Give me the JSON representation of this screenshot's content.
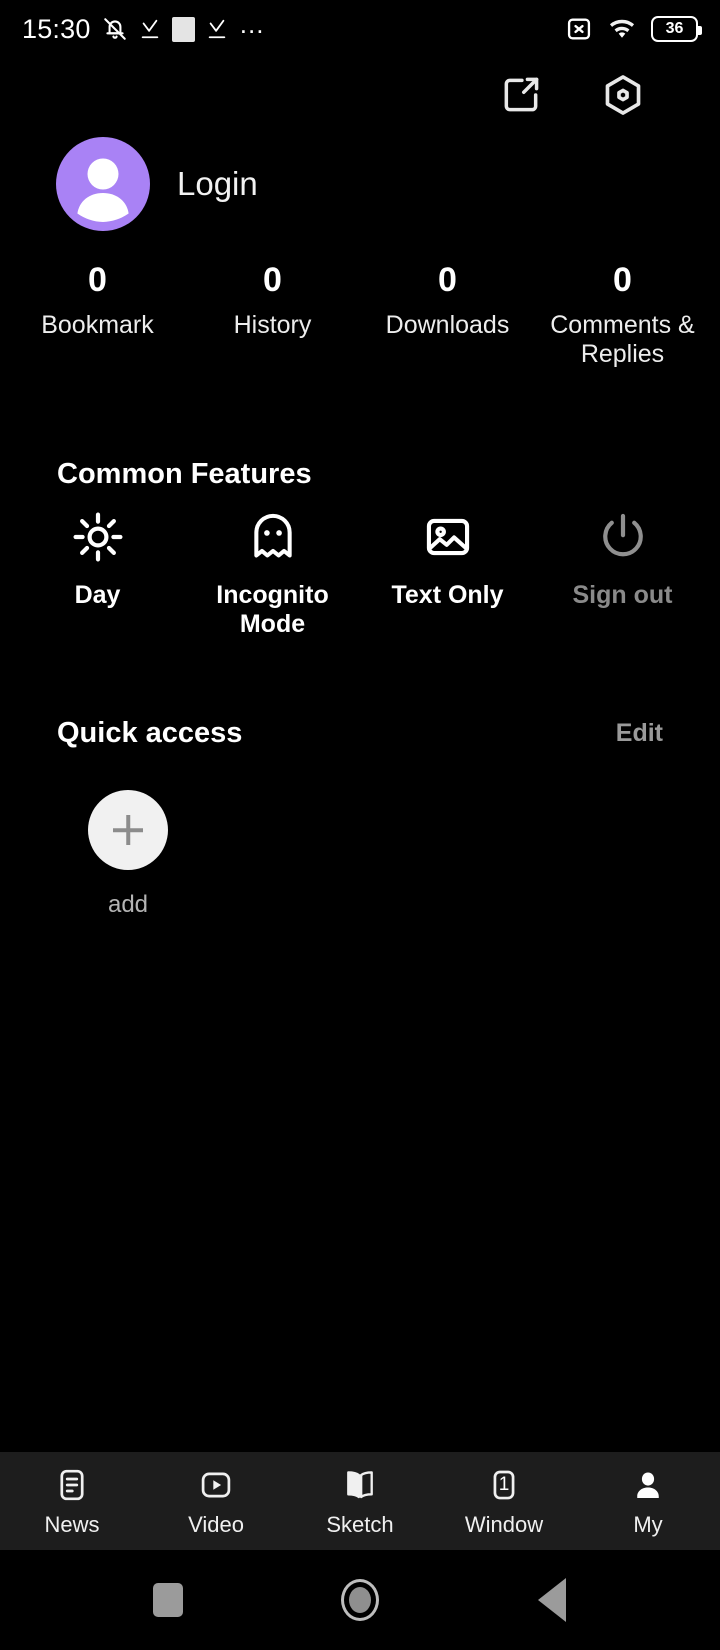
{
  "status_bar": {
    "time": "15:30",
    "icons_left": [
      "bell-muted-icon",
      "download-check-icon",
      "white-square-icon",
      "download-check-icon",
      "overflow-dots-icon"
    ],
    "icons_right": [
      "sim-disabled-icon",
      "wifi-icon",
      "battery-icon"
    ],
    "battery_level": "36"
  },
  "top_actions": {
    "share_label": "share-icon",
    "settings_label": "settings-hexagon-icon"
  },
  "account": {
    "login_label": "Login",
    "avatar_color": "#a982f5",
    "avatar_icon": "person-icon"
  },
  "stats": [
    {
      "count": "0",
      "label": "Bookmark"
    },
    {
      "count": "0",
      "label": "History"
    },
    {
      "count": "0",
      "label": "Downloads"
    },
    {
      "count": "0",
      "label": "Comments & Replies"
    }
  ],
  "common_features": {
    "title": "Common Features",
    "items": [
      {
        "label": "Day",
        "icon": "sun-icon",
        "disabled": false
      },
      {
        "label": "Incognito Mode",
        "icon": "ghost-icon",
        "disabled": false
      },
      {
        "label": "Text Only",
        "icon": "image-icon",
        "disabled": false
      },
      {
        "label": "Sign out",
        "icon": "power-icon",
        "disabled": true
      }
    ]
  },
  "quick_access": {
    "title": "Quick access",
    "edit_label": "Edit",
    "items": [
      {
        "label": "add",
        "icon": "plus-icon"
      }
    ]
  },
  "bottom_nav": {
    "items": [
      {
        "label": "News",
        "icon": "news-document-icon",
        "active": false,
        "badge": ""
      },
      {
        "label": "Video",
        "icon": "video-play-icon",
        "active": false,
        "badge": ""
      },
      {
        "label": "Sketch",
        "icon": "open-book-icon",
        "active": false,
        "badge": ""
      },
      {
        "label": "Window",
        "icon": "window-count-icon",
        "active": false,
        "badge": "1"
      },
      {
        "label": "My",
        "icon": "person-filled-icon",
        "active": true,
        "badge": ""
      }
    ]
  },
  "system_nav": {
    "recents_label": "recents-square-icon",
    "home_label": "home-circle-icon",
    "back_label": "back-triangle-icon"
  },
  "colors": {
    "background": "#000000",
    "nav_background": "#1d1d1d",
    "accent_purple": "#a982f5",
    "muted_text": "#8a8a8a"
  }
}
